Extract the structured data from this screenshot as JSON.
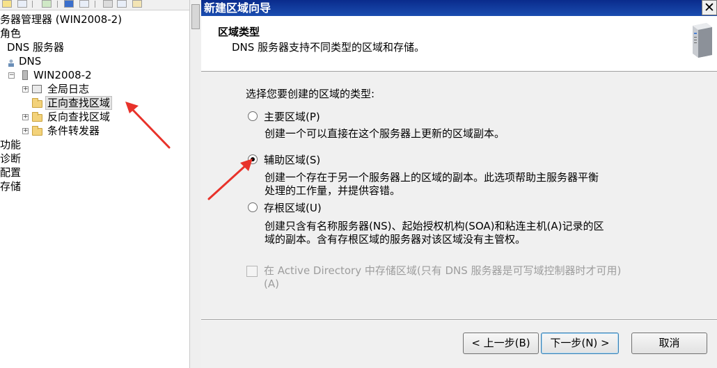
{
  "tree": {
    "server_manager": "务器管理器 (WIN2008-2)",
    "roles": "角色",
    "dns_server": "DNS 服务器",
    "dns": "DNS",
    "server_name": "WIN2008-2",
    "global_logs": "全局日志",
    "forward_zones": "正向查找区域",
    "reverse_zones": "反向查找区域",
    "conditional_forwarders": "条件转发器",
    "features": "功能",
    "diagnostics": "诊断",
    "configuration": "配置",
    "storage": "存储"
  },
  "wizard": {
    "title": "新建区域向导",
    "header_title": "区域类型",
    "header_subtitle": "DNS 服务器支持不同类型的区域和存储。",
    "prompt": "选择您要创建的区域的类型:",
    "options": [
      {
        "label": "主要区域(P)",
        "desc": [
          "创建一个可以直接在这个服务器上更新的区域副本。"
        ],
        "checked": false
      },
      {
        "label": "辅助区域(S)",
        "desc": [
          "创建一个存在于另一个服务器上的区域的副本。此选项帮助主服务器平衡",
          "处理的工作量，并提供容错。"
        ],
        "checked": true
      },
      {
        "label": "存根区域(U)",
        "desc": [
          "创建只含有名称服务器(NS)、起始授权机构(SOA)和粘连主机(A)记录的区",
          "域的副本。含有存根区域的服务器对该区域没有主管权。"
        ],
        "checked": false
      }
    ],
    "ad_checkbox": {
      "line1": "在 Active Directory 中存储区域(只有 DNS 服务器是可写域控制器时才可用)",
      "line2": "(A)",
      "checked": false,
      "enabled": false
    },
    "buttons": {
      "back": "< 上一步(B)",
      "next": "下一步(N) >",
      "cancel": "取消"
    }
  },
  "colors": {
    "title_bar": "#0a2b8c",
    "annotation_arrow": "#e8322a"
  },
  "icons": [
    "close-icon",
    "server-icon",
    "folder-icon"
  ]
}
